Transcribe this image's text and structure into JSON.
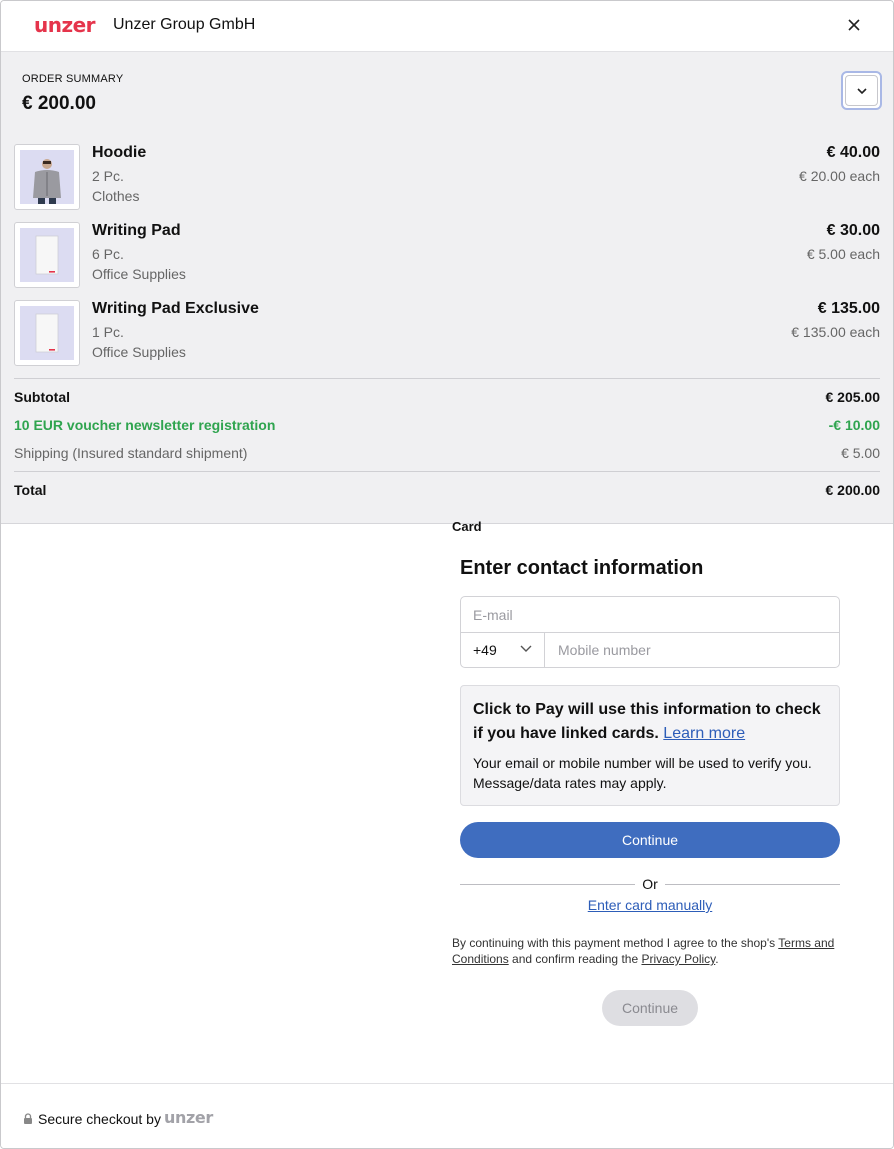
{
  "header": {
    "brand_logo": "unzer",
    "merchant_name": "Unzer Group GmbH",
    "close_icon": "close-icon"
  },
  "summary": {
    "title": "ORDER SUMMARY",
    "amount": "€ 200.00",
    "toggle_icon": "chevron-down-icon",
    "items": [
      {
        "name": "Hoodie",
        "qty": "2 Pc.",
        "category": "Clothes",
        "price": "€ 40.00",
        "each": "€ 20.00 each",
        "image": "hoodie-image"
      },
      {
        "name": "Writing Pad",
        "qty": "6 Pc.",
        "category": "Office Supplies",
        "price": "€ 30.00",
        "each": "€ 5.00 each",
        "image": "writing-pad-image"
      },
      {
        "name": "Writing Pad Exclusive",
        "qty": "1 Pc.",
        "category": "Office Supplies",
        "price": "€ 135.00",
        "each": "€ 135.00 each",
        "image": "writing-pad-image"
      }
    ],
    "subtotal_label": "Subtotal",
    "subtotal_value": "€ 205.00",
    "voucher_label": "10 EUR voucher newsletter registration",
    "voucher_value": "-€ 10.00",
    "shipping_label": "Shipping (Insured standard shipment)",
    "shipping_value": "€ 5.00",
    "total_label": "Total",
    "total_value": "€ 200.00"
  },
  "payment": {
    "method_label": "Card",
    "contact_title": "Enter contact information",
    "email_placeholder": "E-mail",
    "country_code": "+49",
    "mobile_placeholder": "Mobile number",
    "info_heading": "Click to Pay will use this information to check if you have linked cards.",
    "learn_more": "Learn more",
    "info_body": "Your email or mobile number will be used to verify you. Message/data rates may apply.",
    "continue_label": "Continue",
    "or_label": "Or",
    "manual_link": "Enter card manually",
    "terms_prefix": "By continuing with this payment method I agree to the shop's",
    "terms_link": "Terms and Conditions",
    "terms_middle": "and confirm reading the",
    "privacy_link": "Privacy Policy",
    "terms_suffix": ".",
    "continue_disabled_label": "Continue"
  },
  "footer": {
    "secure_text": "Secure checkout by",
    "logo": "unzer",
    "lock_icon": "lock-icon"
  },
  "colors": {
    "brand": "#e5344b",
    "primary_button": "#3f6dbf",
    "link": "#2d5db8",
    "discount": "#2fa44f",
    "summary_bg": "#f0f0f2"
  }
}
